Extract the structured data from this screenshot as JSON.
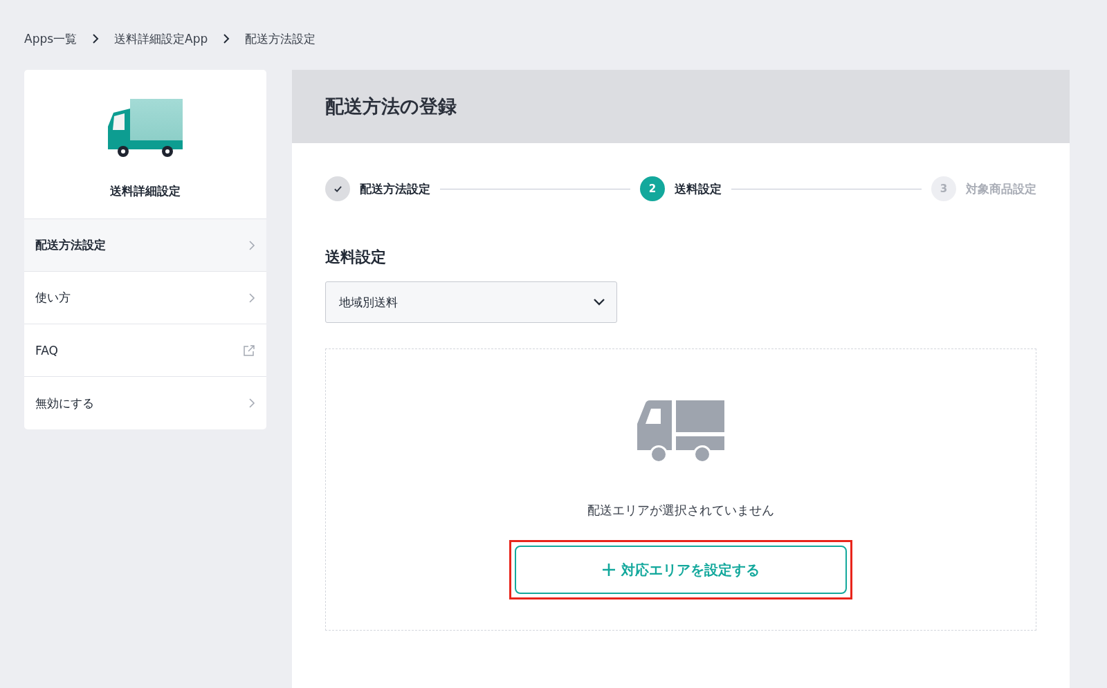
{
  "breadcrumb": [
    "Apps一覧",
    "送料詳細設定App",
    "配送方法設定"
  ],
  "sidebar": {
    "app_name": "送料詳細設定",
    "items": [
      {
        "label": "配送方法設定",
        "kind": "page",
        "selected": true
      },
      {
        "label": "使い方",
        "kind": "page",
        "selected": false
      },
      {
        "label": "FAQ",
        "kind": "external",
        "selected": false
      },
      {
        "label": "無効にする",
        "kind": "page",
        "selected": false
      }
    ]
  },
  "main": {
    "title": "配送方法の登録",
    "steps": [
      {
        "label": "配送方法設定",
        "completed": true,
        "selected": false
      },
      {
        "number": "2",
        "label": "送料設定",
        "completed": false,
        "selected": true
      },
      {
        "number": "3",
        "label": "対象商品設定",
        "completed": false,
        "selected": false
      }
    ],
    "section_title": "送料設定",
    "select": {
      "value": "地域別送料"
    },
    "empty_state": {
      "message": "配送エリアが選択されていません",
      "button": {
        "label": "対応エリアを設定する",
        "highlighted": true
      }
    }
  }
}
